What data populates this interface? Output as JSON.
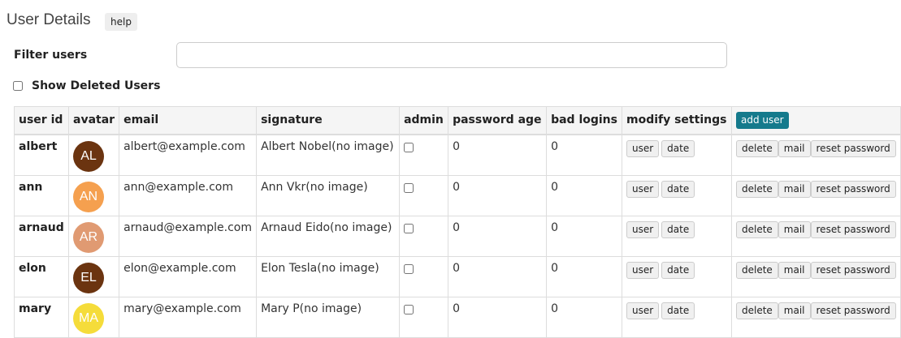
{
  "header": {
    "title": "User Details",
    "help_label": "help"
  },
  "filter": {
    "label": "Filter users",
    "value": "",
    "placeholder": ""
  },
  "show_deleted": {
    "label": "Show Deleted Users",
    "checked": false
  },
  "table": {
    "columns": [
      "user id",
      "avatar",
      "email",
      "signature",
      "admin",
      "password age",
      "bad logins",
      "modify settings"
    ],
    "add_user_label": "add user",
    "row_buttons": {
      "user": "user",
      "date": "date",
      "delete": "delete",
      "mail": "mail",
      "reset": "reset password"
    },
    "rows": [
      {
        "id": "albert",
        "initials": "AL",
        "avatar_color": "#6b3410",
        "email": "albert@example.com",
        "signature": "Albert Nobel(no image)",
        "admin": false,
        "password_age": "0",
        "bad_logins": "0"
      },
      {
        "id": "ann",
        "initials": "AN",
        "avatar_color": "#f5a04f",
        "email": "ann@example.com",
        "signature": "Ann Vkr(no image)",
        "admin": false,
        "password_age": "0",
        "bad_logins": "0"
      },
      {
        "id": "arnaud",
        "initials": "AR",
        "avatar_color": "#e09a72",
        "email": "arnaud@example.com",
        "signature": "Arnaud Eido(no image)",
        "admin": false,
        "password_age": "0",
        "bad_logins": "0"
      },
      {
        "id": "elon",
        "initials": "EL",
        "avatar_color": "#6b3410",
        "email": "elon@example.com",
        "signature": "Elon Tesla(no image)",
        "admin": false,
        "password_age": "0",
        "bad_logins": "0"
      },
      {
        "id": "mary",
        "initials": "MA",
        "avatar_color": "#f5dc3a",
        "email": "mary@example.com",
        "signature": "Mary P(no image)",
        "admin": false,
        "password_age": "0",
        "bad_logins": "0"
      }
    ]
  }
}
